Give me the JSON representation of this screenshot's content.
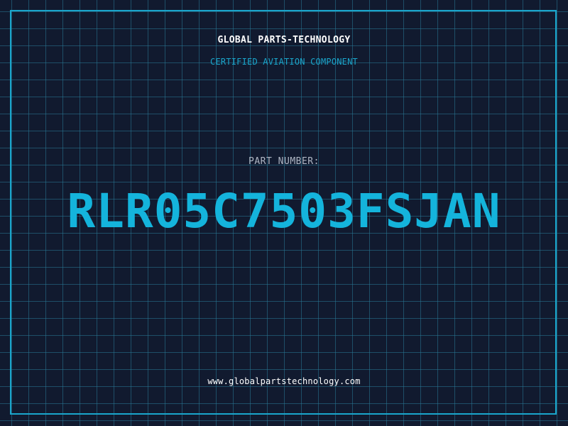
{
  "header": {
    "company": "GLOBAL PARTS-TECHNOLOGY",
    "certification": "CERTIFIED AVIATION COMPONENT"
  },
  "part": {
    "label": "PART NUMBER:",
    "number": "RLR05C7503FSJAN"
  },
  "footer": {
    "website": "www.globalpartstechnology.com"
  },
  "colors": {
    "background": "#111a2f",
    "grid": "#287896",
    "accent": "#14b4dc",
    "text": "#ffffff",
    "label": "#aeb6c4"
  }
}
